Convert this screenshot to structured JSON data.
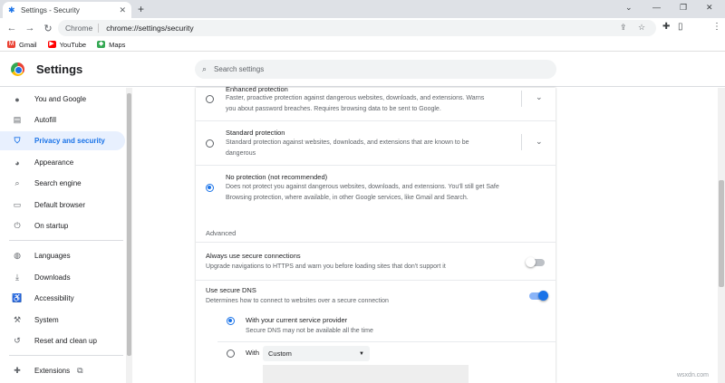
{
  "tab": {
    "title": "Settings - Security",
    "close": "✕"
  },
  "newtab": "+",
  "window": {
    "minimize": "—",
    "restore": "❐",
    "close": "✕"
  },
  "nav": {
    "back": "←",
    "forward": "→",
    "reload": "↻"
  },
  "omnibox": {
    "site_chip": "Chrome",
    "url": "chrome://settings/security"
  },
  "bookmarks": [
    {
      "label": "Gmail",
      "color": "#ea4335",
      "glyph": "M"
    },
    {
      "label": "YouTube",
      "color": "#ff0000",
      "glyph": "▶"
    },
    {
      "label": "Maps",
      "color": "#34a853",
      "glyph": "◆"
    }
  ],
  "header": {
    "title": "Settings",
    "search_placeholder": "Search settings"
  },
  "sidebar": {
    "items": [
      {
        "label": "You and Google",
        "icon": "person-icon",
        "glyph": "👤"
      },
      {
        "label": "Autofill",
        "icon": "clipboard-icon",
        "glyph": "📋"
      },
      {
        "label": "Privacy and security",
        "icon": "shield-icon",
        "glyph": "🛡",
        "active": true
      },
      {
        "label": "Appearance",
        "icon": "palette-icon",
        "glyph": "🎨"
      },
      {
        "label": "Search engine",
        "icon": "search-icon",
        "glyph": "⌕"
      },
      {
        "label": "Default browser",
        "icon": "browser-icon",
        "glyph": "▭"
      },
      {
        "label": "On startup",
        "icon": "power-icon",
        "glyph": "⏻"
      },
      {
        "label": "Languages",
        "icon": "globe-icon",
        "glyph": "🌐"
      },
      {
        "label": "Downloads",
        "icon": "download-icon",
        "glyph": "⤓"
      },
      {
        "label": "Accessibility",
        "icon": "accessibility-icon",
        "glyph": "♿"
      },
      {
        "label": "System",
        "icon": "wrench-icon",
        "glyph": "🔧"
      },
      {
        "label": "Reset and clean up",
        "icon": "history-icon",
        "glyph": "↺"
      },
      {
        "label": "Extensions",
        "icon": "puzzle-icon",
        "glyph": "🧩"
      }
    ]
  },
  "protection": {
    "enhanced": {
      "title": "Enhanced protection",
      "desc1": "Faster, proactive protection against dangerous websites, downloads, and extensions. Warns",
      "desc2": "you about password breaches. Requires browsing data to be sent to Google."
    },
    "standard": {
      "title": "Standard protection",
      "desc1": "Standard protection against websites, downloads, and extensions that are known to be",
      "desc2": "dangerous"
    },
    "none": {
      "title": "No protection (not recommended)",
      "desc1": "Does not protect you against dangerous websites, downloads, and extensions. You'll still get Safe",
      "desc2": "Browsing protection, where available, in other Google services, like Gmail and Search."
    },
    "selected": "none"
  },
  "advanced": {
    "heading": "Advanced",
    "https": {
      "title": "Always use secure connections",
      "desc": "Upgrade navigations to HTTPS and warn you before loading sites that don't support it",
      "enabled": false
    },
    "dns": {
      "title": "Use secure DNS",
      "desc": "Determines how to connect to websites over a secure connection",
      "enabled": true,
      "provider_title": "With your current service provider",
      "provider_desc": "Secure DNS may not be available all the time",
      "with_label": "With",
      "custom_value": "Custom",
      "selected": "provider"
    }
  },
  "watermark": "wsxdn.com",
  "colors": {
    "accent": "#1a73e8",
    "active_bg": "#e8f0fe"
  }
}
